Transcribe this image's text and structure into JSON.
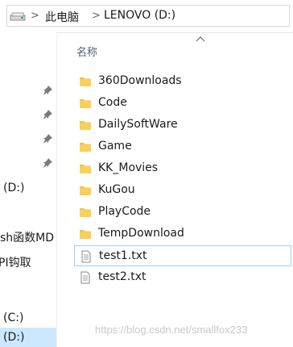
{
  "address_bar": {
    "crumbs": [
      "此电脑",
      "LENOVO (D:)"
    ],
    "separators": [
      ">",
      ">"
    ]
  },
  "nav": {
    "pins": 4,
    "items": [
      {
        "label": "(D:)"
      },
      {
        "label": "sh函数MD"
      },
      {
        "label": "PI钩取"
      },
      {
        "label": "(C:)"
      },
      {
        "label": "(D:)",
        "selected": true
      }
    ]
  },
  "content": {
    "column_name": "名称",
    "files": [
      {
        "name": "360Downloads",
        "type": "folder"
      },
      {
        "name": "Code",
        "type": "folder"
      },
      {
        "name": "DailySoftWare",
        "type": "folder"
      },
      {
        "name": "Game",
        "type": "folder"
      },
      {
        "name": "KK_Movies",
        "type": "folder"
      },
      {
        "name": "KuGou",
        "type": "folder"
      },
      {
        "name": "PlayCode",
        "type": "folder"
      },
      {
        "name": "TempDownload",
        "type": "folder"
      },
      {
        "name": "test1.txt",
        "type": "text",
        "selected": true
      },
      {
        "name": "test2.txt",
        "type": "text"
      }
    ]
  },
  "watermark": "https://blog.csdn.net/smallfox233",
  "colors": {
    "folder": "#f5c242",
    "folder_dark": "#e0a623",
    "selection_border": "#99d1ff",
    "nav_selected": "#cce8ff",
    "header_text": "#4d6082"
  }
}
